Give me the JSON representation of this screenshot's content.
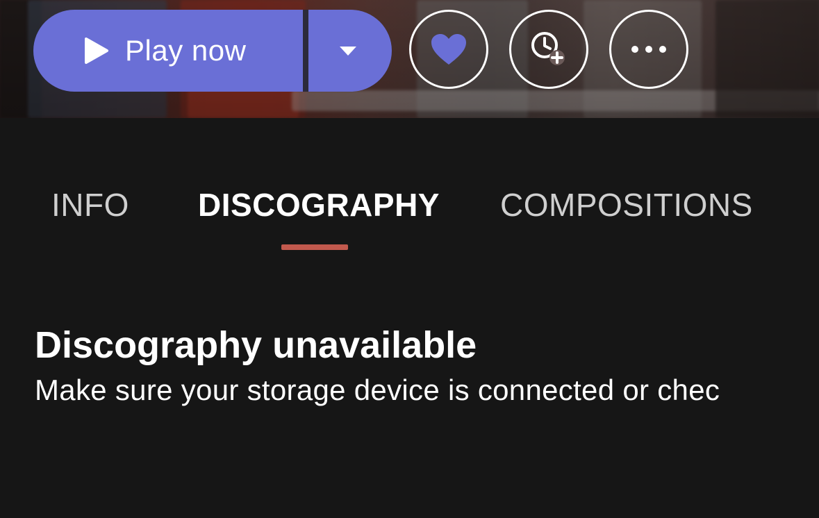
{
  "header": {
    "play_button": {
      "label": "Play now",
      "icon": "play-icon"
    },
    "dropdown_icon": "chevron-down-icon",
    "actions": [
      {
        "name": "favorite",
        "icon": "heart-icon"
      },
      {
        "name": "play-later",
        "icon": "clock-add-icon"
      },
      {
        "name": "more",
        "icon": "more-dots-icon"
      }
    ]
  },
  "tabs": [
    {
      "label": "INFO",
      "active": false
    },
    {
      "label": "DISCOGRAPHY",
      "active": true
    },
    {
      "label": "COMPOSITIONS",
      "active": false
    }
  ],
  "empty_state": {
    "title": "Discography unavailable",
    "message": "Make sure your storage device is connected or chec"
  },
  "colors": {
    "accent": "#6a6fd6",
    "tab_indicator": "#c2594d",
    "background": "#161616",
    "heart": "#6a6fd6"
  }
}
